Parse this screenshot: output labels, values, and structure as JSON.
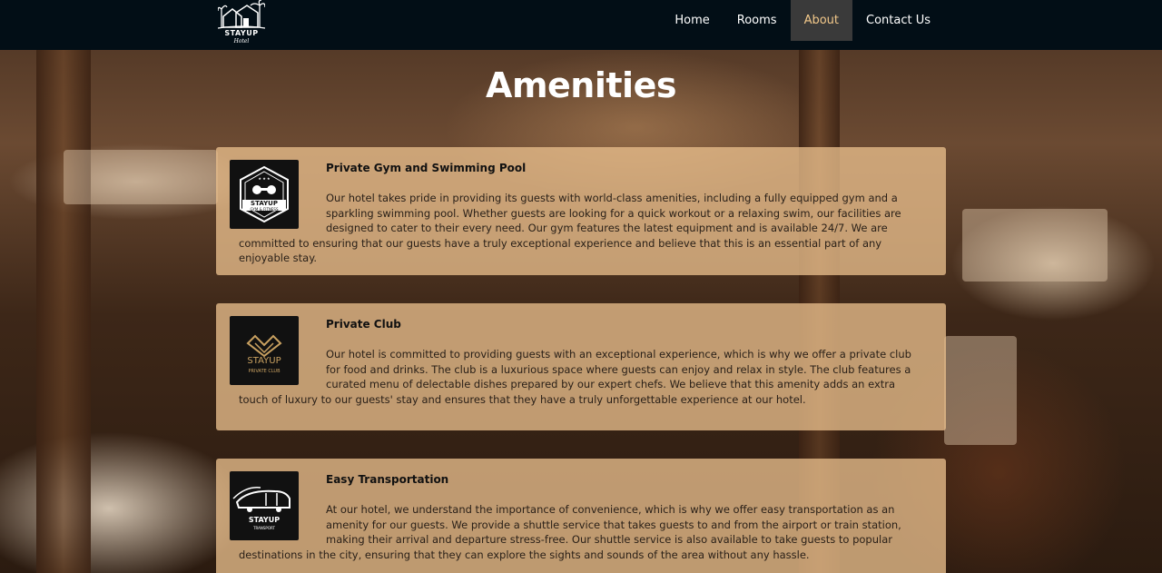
{
  "brand": {
    "name": "STAYUP",
    "sub": "Hotel"
  },
  "nav": {
    "items": [
      {
        "label": "Home",
        "active": false
      },
      {
        "label": "Rooms",
        "active": false
      },
      {
        "label": "About",
        "active": true
      },
      {
        "label": "Contact Us",
        "active": false
      }
    ]
  },
  "page": {
    "title": "Amenities"
  },
  "amenities": [
    {
      "title": "Private Gym and Swimming Pool",
      "logo_text": "STAYUP",
      "logo_sub": "GYM & FITNESS",
      "text": "Our hotel takes pride in providing its guests with world-class amenities, including a fully equipped gym and a sparkling swimming pool. Whether guests are looking for a quick workout or a relaxing swim, our facilities are designed to cater to their every need. Our gym features the latest equipment and is available 24/7. We are committed to ensuring that our guests have a truly exceptional experience and believe that this is an essential part of any enjoyable stay."
    },
    {
      "title": "Private Club",
      "logo_text": "STAYUP",
      "logo_sub": "PRIVATE CLUB",
      "text": "Our hotel is committed to providing guests with an exceptional experience, which is why we offer a private club for food and drinks. The club is a luxurious space where guests can enjoy and relax in style. The club features a curated menu of delectable dishes prepared by our expert chefs. We believe that this amenity adds an extra touch of luxury to our guests' stay and ensures that they have a truly unforgettable experience at our hotel."
    },
    {
      "title": "Easy Transportation",
      "logo_text": "STAYUP",
      "logo_sub": "TRANSPORT",
      "text": "At our hotel, we understand the importance of convenience, which is why we offer easy transportation as an amenity for our guests. We provide a shuttle service that takes guests to and from the airport or train station, making their arrival and departure stress-free. Our shuttle service is also available to take guests to popular destinations in the city, ensuring that they can explore the sights and sounds of the area without any hassle."
    }
  ],
  "colors": {
    "navbar": "#020e16",
    "active_nav": "#f2c88a",
    "card": "#e8be8c"
  }
}
